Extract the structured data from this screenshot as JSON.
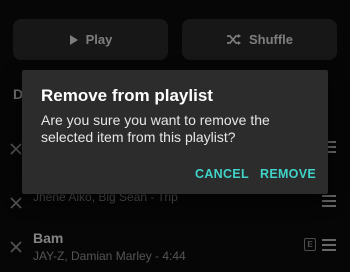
{
  "top_buttons": {
    "play_label": "Play",
    "shuffle_label": "Shuffle"
  },
  "list": {
    "header_partial": "D",
    "rows": [
      {
        "title": "",
        "subtitle": ""
      },
      {
        "title": "",
        "subtitle": "Jhené Aiko, Big Sean - Trip"
      },
      {
        "title": "Bam",
        "subtitle": "JAY-Z, Damian Marley - 4:44",
        "badge": "E"
      }
    ]
  },
  "dialog": {
    "title": "Remove from playlist",
    "message": "Are you sure you want to remove the selected item from this playlist?",
    "cancel_label": "CANCEL",
    "remove_label": "REMOVE"
  },
  "colors": {
    "accent": "#3fd3c9",
    "background": "#0b0b0b",
    "dialog": "#2c2c2c"
  }
}
